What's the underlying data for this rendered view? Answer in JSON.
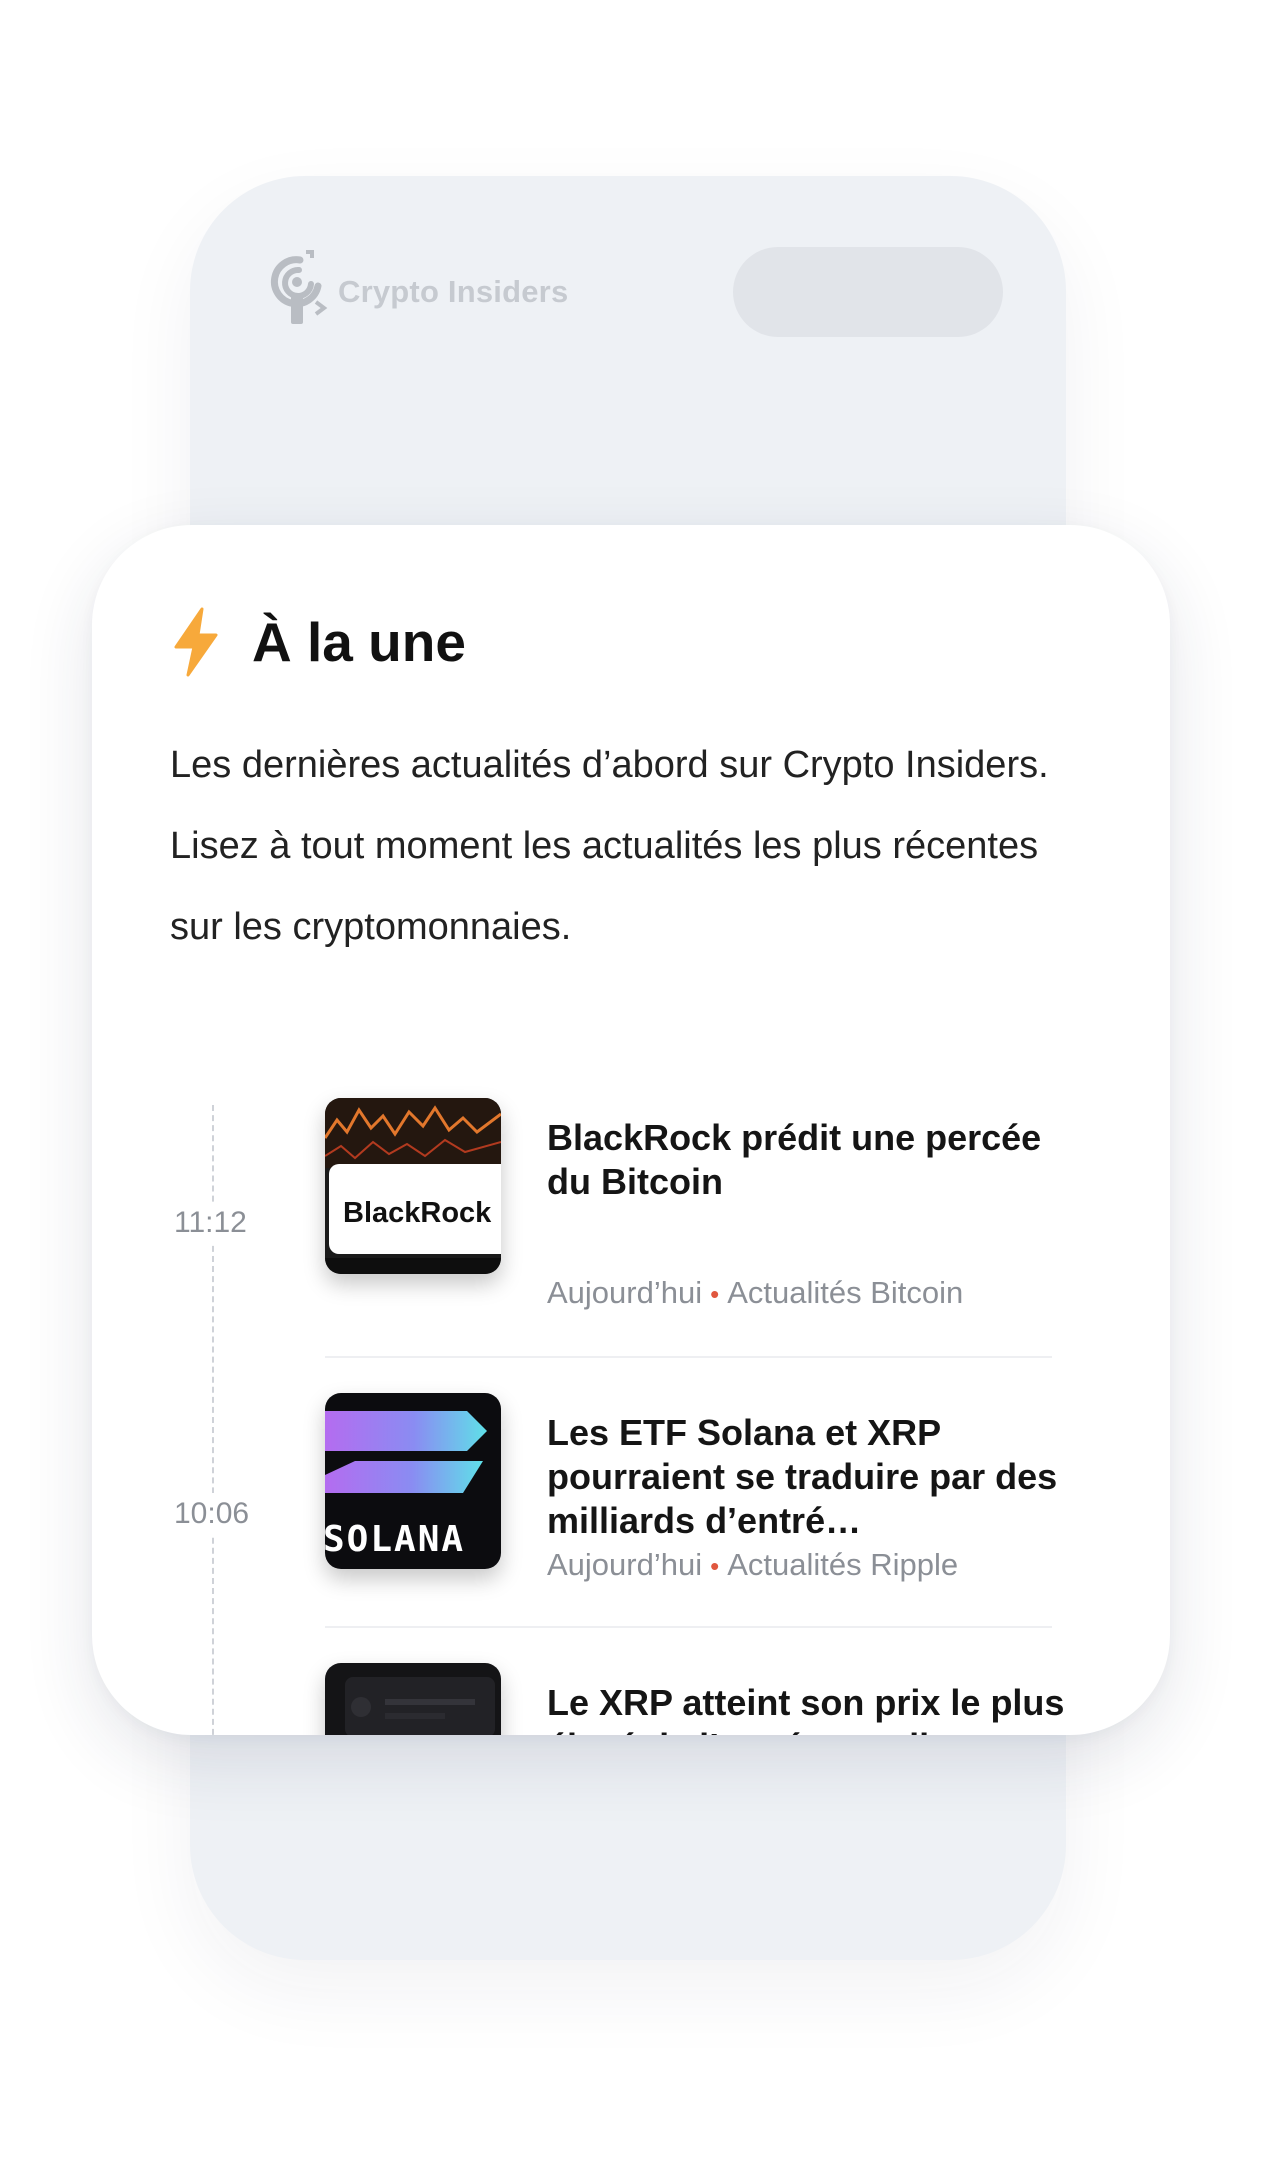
{
  "brand": {
    "name": "Crypto Insiders"
  },
  "section": {
    "icon": "lightning-bolt-icon",
    "title": "À la une",
    "description": "Les dernières actualités d’abord sur Crypto Insiders. Lisez à tout moment les actualités les plus récentes sur les cryptomonnaies."
  },
  "news": [
    {
      "time": "11:12",
      "thumb_text": "BlackRock",
      "headline": "BlackRock prédit une percée du Bitcoin",
      "date": "Aujourd’hui",
      "category": "Actualités Bitcoin"
    },
    {
      "time": "10:06",
      "thumb_text": "SOLANA",
      "headline": "Les ETF Solana et XRP pourraient se traduire par des milliards d’entré…",
      "date": "Aujourd’hui",
      "category": "Actualités Ripple"
    },
    {
      "headline": "Le XRP atteint son prix le plus élevé de l’année, tandis"
    }
  ],
  "colors": {
    "accent_bolt": "#f7a93b",
    "meta_dot": "#e0573f",
    "phone_bg": "#eef1f5"
  }
}
